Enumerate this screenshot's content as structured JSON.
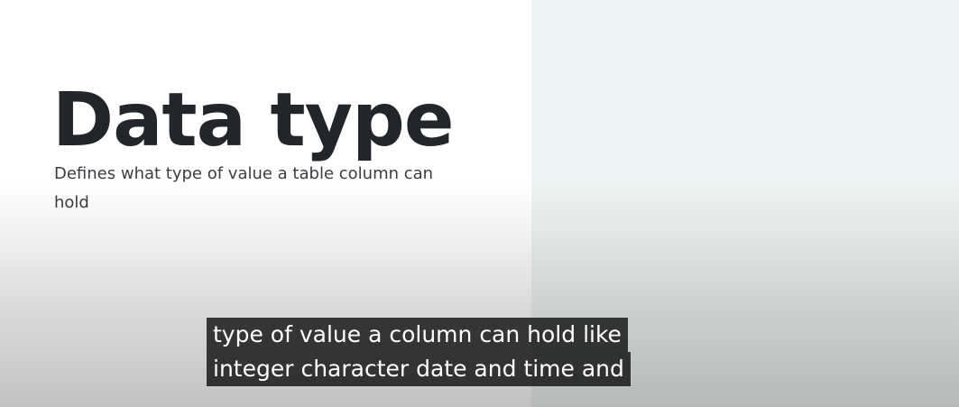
{
  "slide": {
    "title": "Data type",
    "subtitle": "Defines what type of value a table column can hold"
  },
  "captions": {
    "lines": [
      "type of value a column can hold like",
      "integer character date and time and"
    ]
  },
  "colors": {
    "title_text": "#22262b",
    "subtitle_text": "#3a3d42",
    "right_panel": "#eef4f3",
    "caption_background": "#080808",
    "caption_text": "#ffffff"
  }
}
